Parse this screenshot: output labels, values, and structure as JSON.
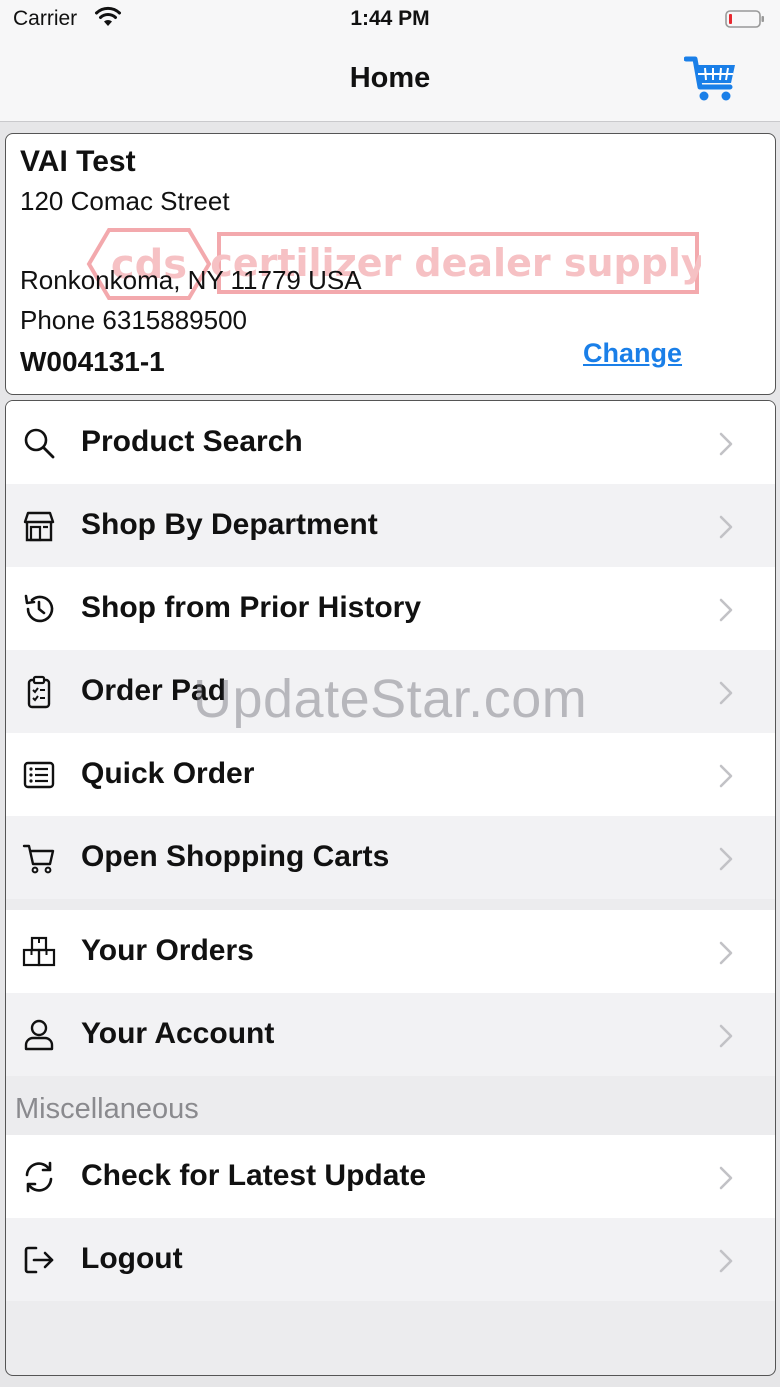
{
  "status_bar": {
    "carrier": "Carrier",
    "time": "1:44 PM"
  },
  "nav": {
    "title": "Home",
    "cart_icon": "shopping-cart-icon"
  },
  "customer": {
    "name": "VAI Test",
    "address_line1": "120 Comac Street",
    "address_line2": "Ronkonkoma, NY 11779 USA",
    "phone": "Phone 6315889500",
    "account": "W004131-1",
    "change_label": "Change",
    "logo_text": "cds certilizer dealer supply"
  },
  "menu": {
    "items": [
      {
        "label": "Product Search",
        "icon": "search-icon"
      },
      {
        "label": "Shop By Department",
        "icon": "store-icon"
      },
      {
        "label": "Shop from Prior History",
        "icon": "history-icon"
      },
      {
        "label": "Order Pad",
        "icon": "clipboard-icon"
      },
      {
        "label": "Quick Order",
        "icon": "list-icon"
      },
      {
        "label": "Open Shopping Carts",
        "icon": "cart-icon"
      },
      {
        "label": "Your Orders",
        "icon": "boxes-icon"
      },
      {
        "label": "Your Account",
        "icon": "user-icon"
      }
    ],
    "misc_header": "Miscellaneous",
    "misc_items": [
      {
        "label": "Check for Latest Update",
        "icon": "refresh-icon"
      },
      {
        "label": "Logout",
        "icon": "logout-icon"
      }
    ]
  },
  "watermark": "UpdateStar.com",
  "colors": {
    "link": "#1a7fe8",
    "cart": "#1a7fe8",
    "logo": "#e8454d"
  }
}
